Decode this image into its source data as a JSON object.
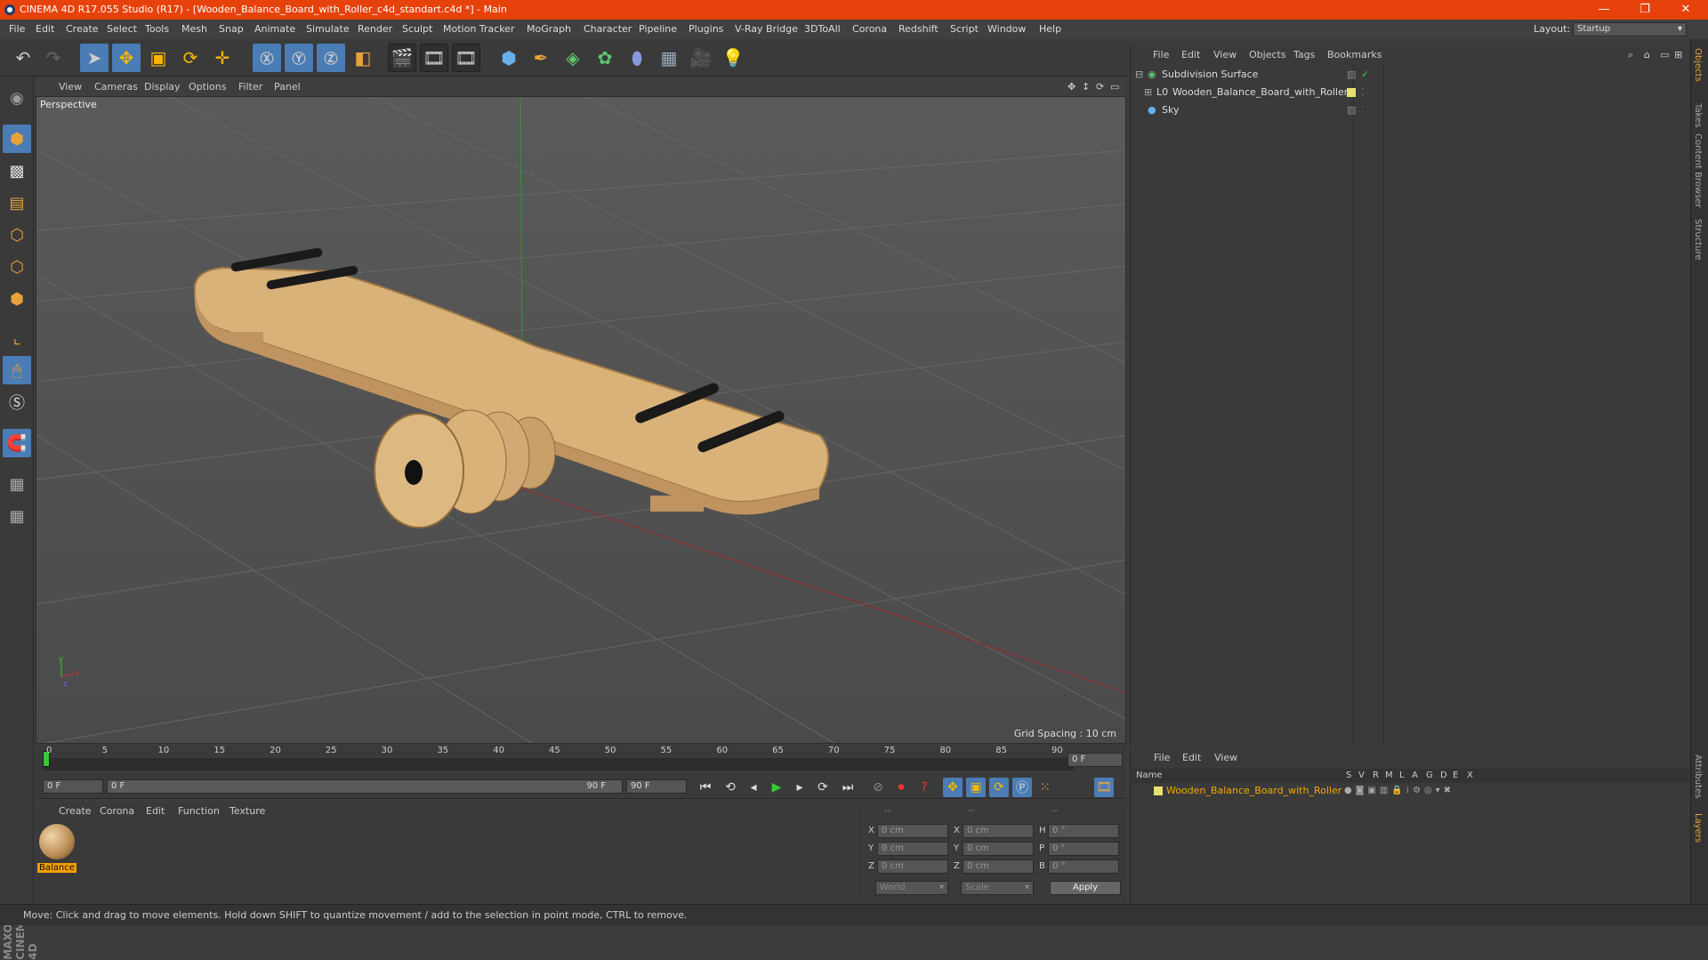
{
  "window": {
    "title": "CINEMA 4D R17.055 Studio (R17) - [Wooden_Balance_Board_with_Roller_c4d_standart.c4d *] - Main",
    "minimize": "—",
    "restore": "❐",
    "close": "✕"
  },
  "menubar": {
    "items": [
      "File",
      "Edit",
      "Create",
      "Select",
      "Tools",
      "Mesh",
      "Snap",
      "Animate",
      "Simulate",
      "Render",
      "Sculpt",
      "Motion Tracker",
      "MoGraph",
      "Character",
      "Pipeline",
      "Plugins",
      "V-Ray Bridge",
      "3DToAll",
      "Corona",
      "Redshift",
      "Script",
      "Window",
      "Help"
    ],
    "layout_label": "Layout:",
    "layout_value": "Startup"
  },
  "viewport": {
    "menu": [
      "View",
      "Cameras",
      "Display",
      "Options",
      "Filter",
      "Panel"
    ],
    "label": "Perspective",
    "grid_spacing": "Grid Spacing : 10 cm"
  },
  "timeline": {
    "ticks": [
      "0",
      "5",
      "10",
      "15",
      "20",
      "25",
      "30",
      "35",
      "40",
      "45",
      "50",
      "55",
      "60",
      "65",
      "70",
      "75",
      "80",
      "85",
      "90"
    ],
    "current_frame": "0 F",
    "start": "0 F",
    "range_start": "0 F",
    "range_end": "90 F",
    "end": "90 F"
  },
  "material": {
    "menu": [
      "Create",
      "Corona",
      "Edit",
      "Function",
      "Texture"
    ],
    "name": "Balance"
  },
  "coords": {
    "labels_col1": [
      "X",
      "Y",
      "Z"
    ],
    "labels_col2": [
      "X",
      "Y",
      "Z"
    ],
    "labels_col3": [
      "H",
      "P",
      "B"
    ],
    "pos": [
      "0 cm",
      "0 cm",
      "0 cm"
    ],
    "size": [
      "0 cm",
      "0 cm",
      "0 cm"
    ],
    "rot": [
      "0 °",
      "0 °",
      "0 °"
    ],
    "dashes": "--",
    "mode1": "World",
    "mode2": "Scale",
    "apply": "Apply"
  },
  "objects": {
    "menu": [
      "File",
      "Edit",
      "View",
      "Objects",
      "Tags",
      "Bookmarks"
    ],
    "items": [
      "Subdivision Surface",
      "Wooden_Balance_Board_with_Roller",
      "Sky"
    ]
  },
  "layers": {
    "menu": [
      "File",
      "Edit",
      "View"
    ],
    "name_header": "Name",
    "cols": [
      "S",
      "V",
      "R",
      "M",
      "L",
      "A",
      "G",
      "D",
      "E",
      "X"
    ],
    "item": "Wooden_Balance_Board_with_Roller"
  },
  "side_tabs": [
    "Objects",
    "Takes",
    "Content Browser",
    "Structure",
    "Attributes",
    "Layers"
  ],
  "status": "Move: Click and drag to move elements. Hold down SHIFT to quantize movement / add to the selection in point mode, CTRL to remove.",
  "brand": "MAXON CINEMA 4D",
  "colors": {
    "title": "#e8420c",
    "accent": "#4a7cb5",
    "wood": "#d9b27a",
    "layer_item": "#f2a900"
  }
}
